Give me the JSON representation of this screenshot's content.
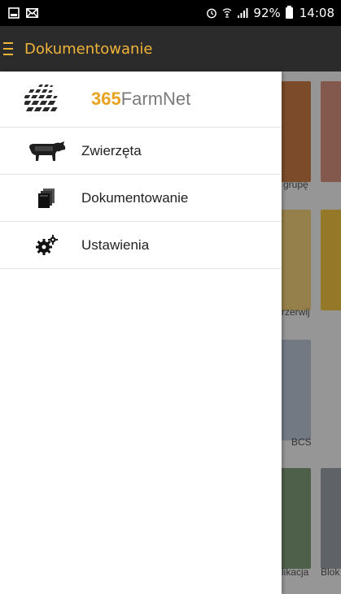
{
  "status_bar": {
    "battery": "92%",
    "time": "14:08"
  },
  "app_bar": {
    "title": "Dokumentowanie"
  },
  "drawer": {
    "brand_number": "365",
    "brand_name": "FarmNet",
    "items": [
      {
        "label": "Zwierzęta",
        "icon": "cow-icon"
      },
      {
        "label": "Dokumentowanie",
        "icon": "documents-icon"
      },
      {
        "label": "Ustawienia",
        "icon": "gears-icon"
      }
    ]
  },
  "background_tiles": {
    "labels": [
      "grupę",
      "rzerwij",
      "BCS",
      "likacja",
      "Blok"
    ]
  },
  "colors": {
    "accent": "#f0b43a",
    "app_bar": "#2b2b2b",
    "brand_number": "#e7a31f"
  }
}
